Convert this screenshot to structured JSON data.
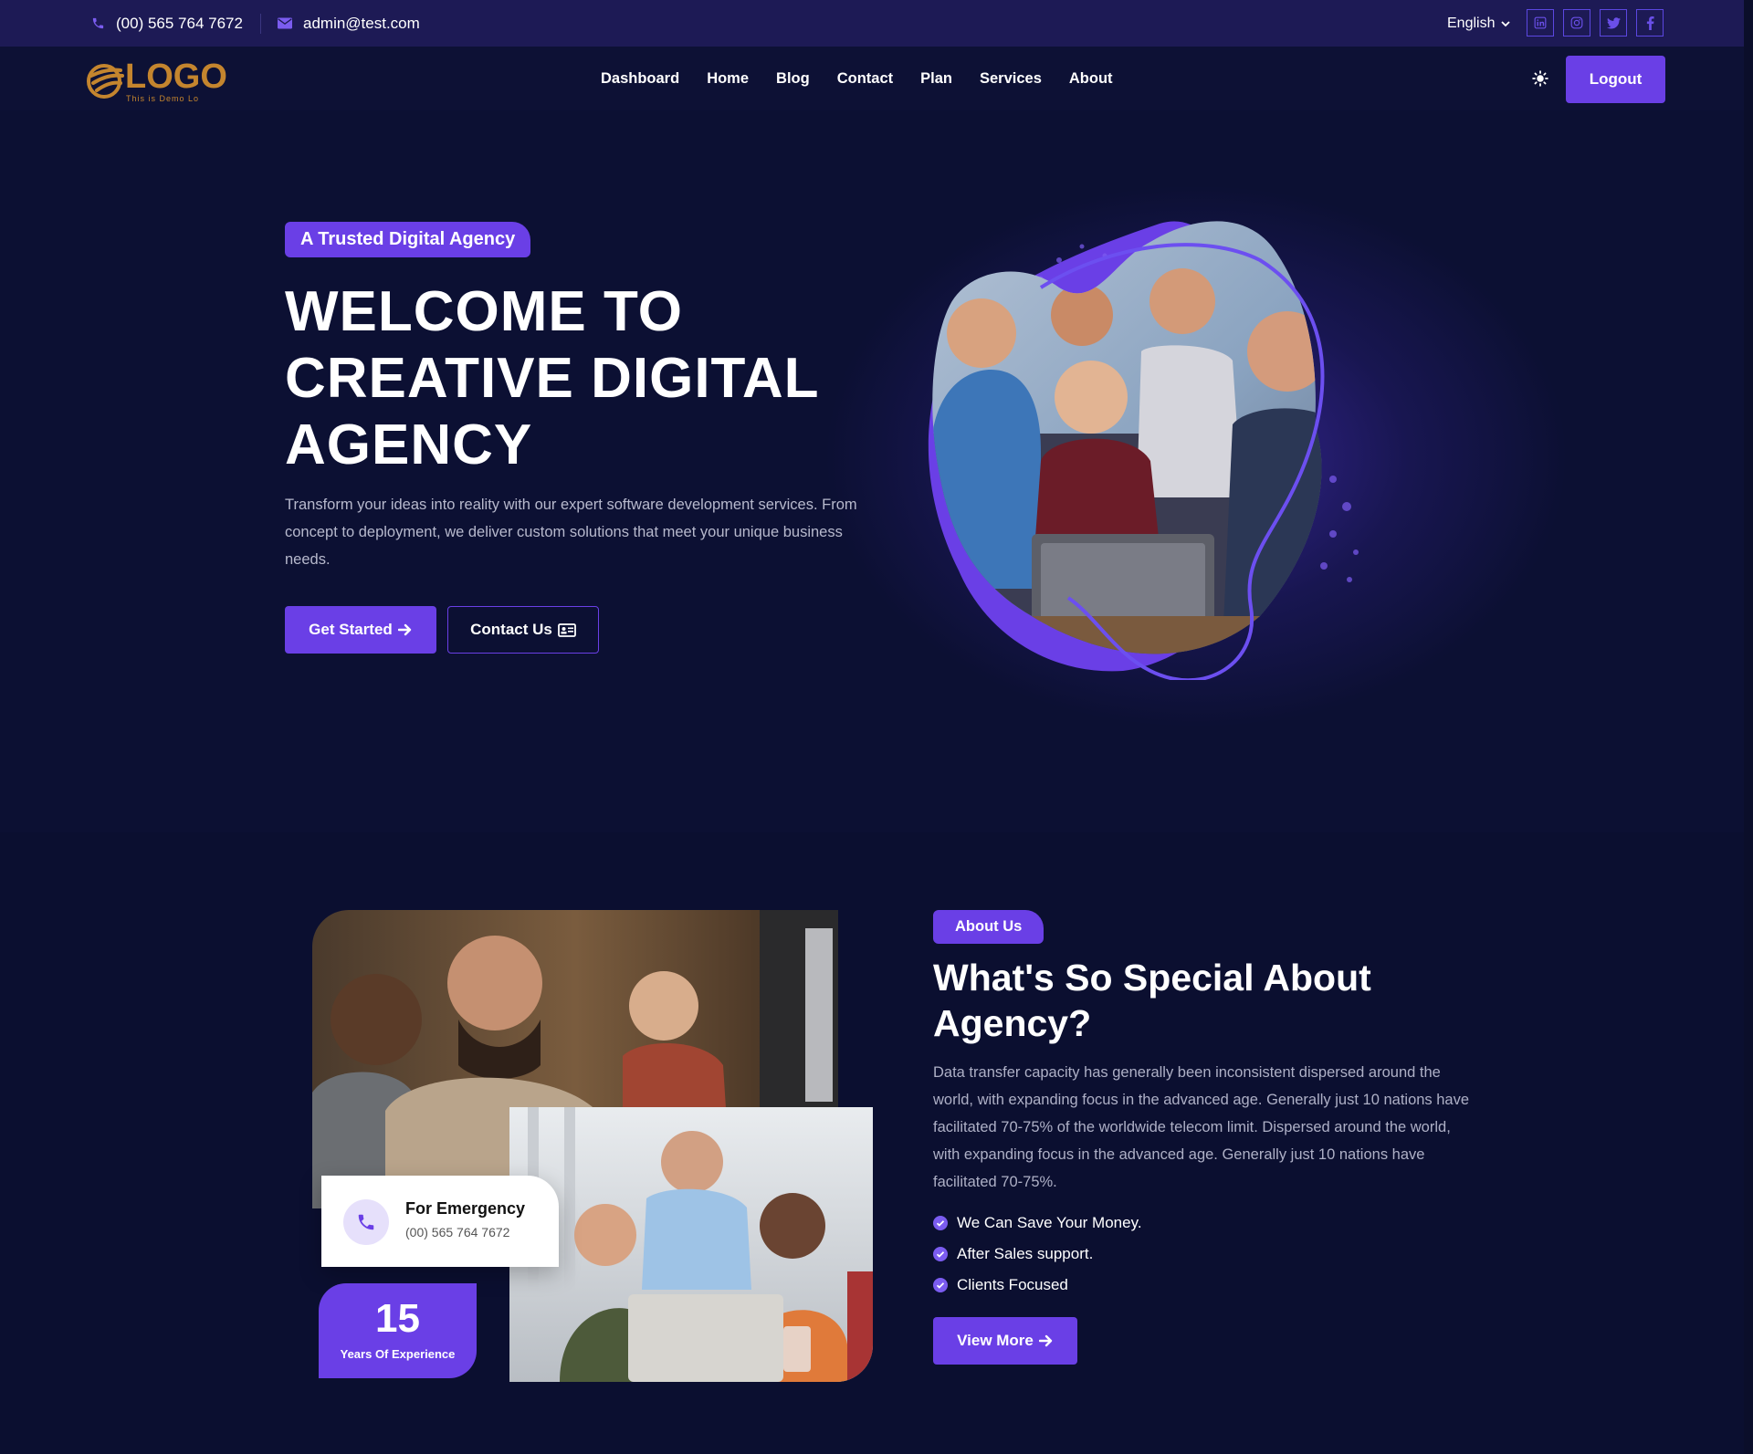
{
  "topbar": {
    "phone": "(00) 565 764 7672",
    "email": "admin@test.com",
    "language": "English",
    "social": [
      "linkedin-icon",
      "instagram-icon",
      "twitter-icon",
      "facebook-icon"
    ]
  },
  "logo": {
    "text": "LOGO",
    "tagline": "This is Demo Lo"
  },
  "nav": {
    "links": [
      "Dashboard",
      "Home",
      "Blog",
      "Contact",
      "Plan",
      "Services",
      "About"
    ],
    "logout_label": "Logout"
  },
  "hero": {
    "badge": "A Trusted Digital Agency",
    "title_line1": "WELCOME TO",
    "title_line2": "CREATIVE DIGITAL",
    "title_line3": "AGENCY",
    "description": "Transform your ideas into reality with our expert software development services. From concept to deployment, we deliver custom solutions that meet your unique business needs.",
    "primary_cta": "Get Started",
    "secondary_cta": "Contact Us"
  },
  "about": {
    "badge": "About Us",
    "title": "What's So Special About Agency?",
    "description": "Data transfer capacity has generally been inconsistent dispersed around the world, with expanding focus in the advanced age. Generally just 10 nations have facilitated 70-75% of the worldwide telecom limit. Dispersed around the world, with expanding focus in the advanced age. Generally just 10 nations have facilitated 70-75%.",
    "features": [
      "We Can Save Your Money.",
      "After Sales support.",
      "Clients Focused"
    ],
    "cta": "View More",
    "emergency_title": "For Emergency",
    "emergency_phone": "(00) 565 764 7672",
    "experience_years": "15",
    "experience_label": "Years Of Experience"
  },
  "colors": {
    "background": "#0c1033",
    "topbar": "#1d1a55",
    "accent": "#6a3fe6",
    "logo": "#c4852e"
  }
}
